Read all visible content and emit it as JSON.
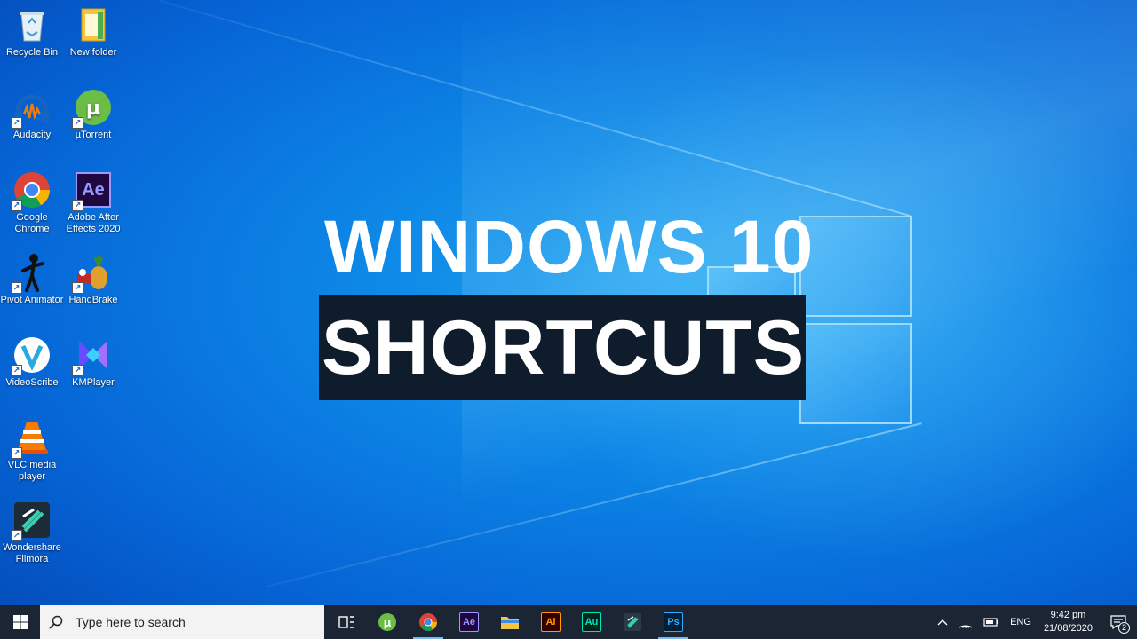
{
  "desktop": {
    "title_line1": "WINDOWS 10",
    "title_line2": "SHORTCUTS",
    "icons": [
      {
        "label": "Recycle Bin"
      },
      {
        "label": "New folder"
      },
      {
        "label": "Audacity"
      },
      {
        "label": "µTorrent"
      },
      {
        "label": "Google Chrome"
      },
      {
        "label": "Adobe After Effects 2020"
      },
      {
        "label": "Pivot Animator"
      },
      {
        "label": "HandBrake"
      },
      {
        "label": "VideoScribe"
      },
      {
        "label": "KMPlayer"
      },
      {
        "label": "VLC media player"
      },
      {
        "label": "Wondershare Filmora"
      }
    ]
  },
  "taskbar": {
    "search_placeholder": "Type here to search",
    "apps": {
      "ae": "Ae",
      "ai": "Ai",
      "au": "Au",
      "ps": "Ps"
    },
    "tray": {
      "language": "ENG",
      "time": "9:42 pm",
      "date": "21/08/2020",
      "notifications_count": "2"
    }
  },
  "colors": {
    "taskbar_bg": "#1b2533",
    "title_box_bg": "#0f1c2b",
    "desktop_accent": "#0d86e6"
  }
}
